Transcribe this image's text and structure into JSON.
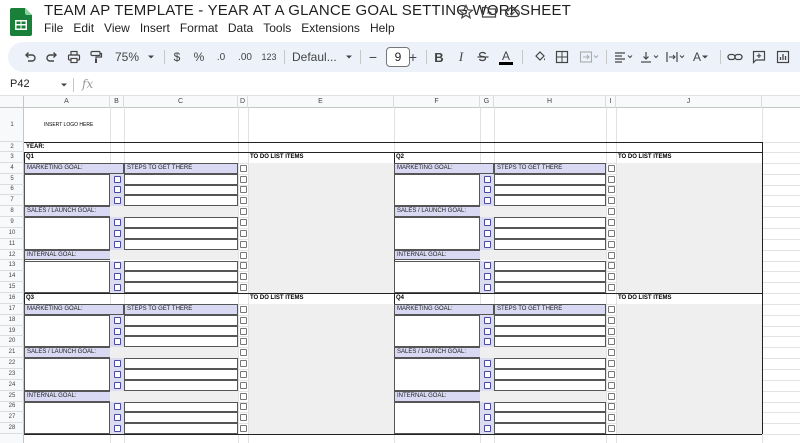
{
  "app": {
    "title": "TEAM AP TEMPLATE - YEAR AT A GLANCE GOAL SETTING WORKSHEET",
    "menu": [
      "File",
      "Edit",
      "View",
      "Insert",
      "Format",
      "Data",
      "Tools",
      "Extensions",
      "Help"
    ],
    "brand_color": "#188038"
  },
  "toolbar": {
    "zoom": "75%",
    "currency": "$",
    "percent": "%",
    "decimal_decrease": ".0",
    "decimal_increase": ".00",
    "number_format": "123",
    "font": "Defaul...",
    "font_size": "9",
    "minus": "−",
    "plus": "+",
    "bold": "B",
    "italic": "I",
    "text_color": "A",
    "text_color_2": "A",
    "icons": [
      "undo-icon",
      "redo-icon",
      "print-icon",
      "paint-format-icon",
      "zoom-caret-icon",
      "bold-icon",
      "italic-icon",
      "strikethrough-icon",
      "text-color-icon",
      "fill-color-icon",
      "borders-icon",
      "merge-cells-icon",
      "horizontal-align-icon",
      "vertical-align-icon",
      "text-wrap-icon",
      "text-rotation-icon",
      "link-icon",
      "comment-icon",
      "chart-icon"
    ]
  },
  "formula_bar": {
    "cell_ref": "P42",
    "fx": "fx",
    "value": ""
  },
  "columns": [
    "A",
    "B",
    "C",
    "D",
    "E",
    "F",
    "G",
    "H",
    "I",
    "J"
  ],
  "rows": [
    "1",
    "2",
    "3",
    "4",
    "5",
    "6",
    "7",
    "8",
    "9",
    "10",
    "11",
    "12",
    "13",
    "14",
    "15",
    "16",
    "17",
    "18",
    "19",
    "20",
    "21",
    "22",
    "23",
    "24",
    "25",
    "26",
    "27",
    "28"
  ],
  "sheet": {
    "logo_placeholder": "INSERT LOGO HERE",
    "year_label": "YEAR:",
    "quarters": [
      {
        "label": "Q1",
        "todo": "TO DO LIST ITEMS",
        "steps": "STEPS TO GET THERE",
        "goals": [
          "MARKETING GOAL:",
          "SALES / LAUNCH GOAL:",
          "INTERNAL GOAL:"
        ]
      },
      {
        "label": "Q2",
        "todo": "TO DO LIST ITEMS",
        "steps": "STEPS TO GET THERE",
        "goals": [
          "MARKETING GOAL:",
          "SALES / LAUNCH GOAL:",
          "INTERNAL GOAL:"
        ]
      },
      {
        "label": "Q3",
        "todo": "TO DO LIST ITEMS",
        "steps": "STEPS TO GET THERE",
        "goals": [
          "MARKETING GOAL:",
          "SALES / LAUNCH GOAL:",
          "INTERNAL GOAL:"
        ]
      },
      {
        "label": "Q4",
        "todo": "TO DO LIST ITEMS",
        "steps": "STEPS TO GET THERE",
        "goals": [
          "MARKETING GOAL:",
          "SALES / LAUNCH GOAL:",
          "INTERNAL GOAL:"
        ]
      }
    ]
  },
  "colors": {
    "goal_header_fill": "#d9d9f3",
    "checkbox_column_fill": "#dcdcf0",
    "todo_fill": "#efefef",
    "toolbar_bg": "#edf2fa"
  }
}
